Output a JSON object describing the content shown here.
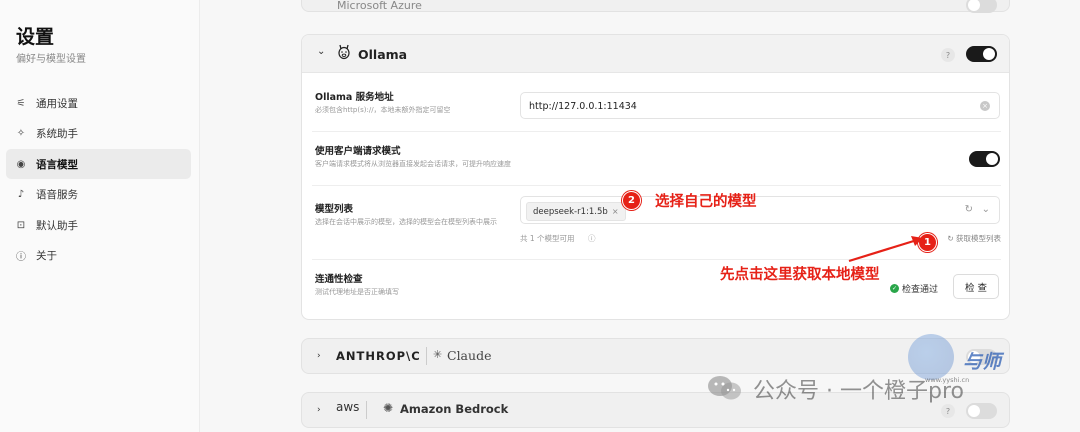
{
  "sidebar": {
    "title": "设置",
    "subtitle": "偏好与模型设置",
    "items": [
      {
        "label": "通用设置",
        "icon": "sliders-icon"
      },
      {
        "label": "系统助手",
        "icon": "sparkle-icon"
      },
      {
        "label": "语言模型",
        "icon": "brain-icon",
        "active": true
      },
      {
        "label": "语音服务",
        "icon": "microphone-icon"
      },
      {
        "label": "默认助手",
        "icon": "bot-icon"
      },
      {
        "label": "关于",
        "icon": "info-icon"
      }
    ]
  },
  "top_card": {
    "label": "Microsoft Azure"
  },
  "ollama": {
    "name": "Ollama",
    "enabled": true,
    "service_address": {
      "label": "Ollama 服务地址",
      "desc": "必须包含http(s)://，本地未额外指定可留空",
      "value": "http://127.0.0.1:11434"
    },
    "client_mode": {
      "label": "使用客户端请求模式",
      "desc": "客户端请求模式将从浏览器直接发起会话请求，可提升响应速度",
      "enabled": true
    },
    "model_list": {
      "label": "模型列表",
      "desc": "选择在会话中展示的模型，选择的模型会在模型列表中展示",
      "selected": "deepseek-r1:1.5b",
      "count_text": "共 1 个模型可用",
      "fetch_label": "获取模型列表"
    },
    "connectivity": {
      "label": "连通性检查",
      "desc": "测试代理地址是否正确填写",
      "status": "检查通过",
      "button": "检 查"
    }
  },
  "providers": [
    {
      "name": "ANTHROP\\C",
      "sub": "Claude",
      "enabled": false
    },
    {
      "name": "aws",
      "sub": "Amazon Bedrock",
      "enabled": false
    }
  ],
  "annotations": {
    "step1_num": "1",
    "step1_text": "先点击这里获取本地模型",
    "step2_num": "2",
    "step2_text": "选择自己的模型",
    "color": "#e62117"
  },
  "watermark": {
    "account": "公众号 · 一个橙子pro",
    "logo_text": "与师",
    "logo_sub": "www.yyshi.cn"
  },
  "help_mark": "?",
  "colors": {
    "accent_toggle": "#1a1a1a",
    "success": "#2aa64a"
  }
}
